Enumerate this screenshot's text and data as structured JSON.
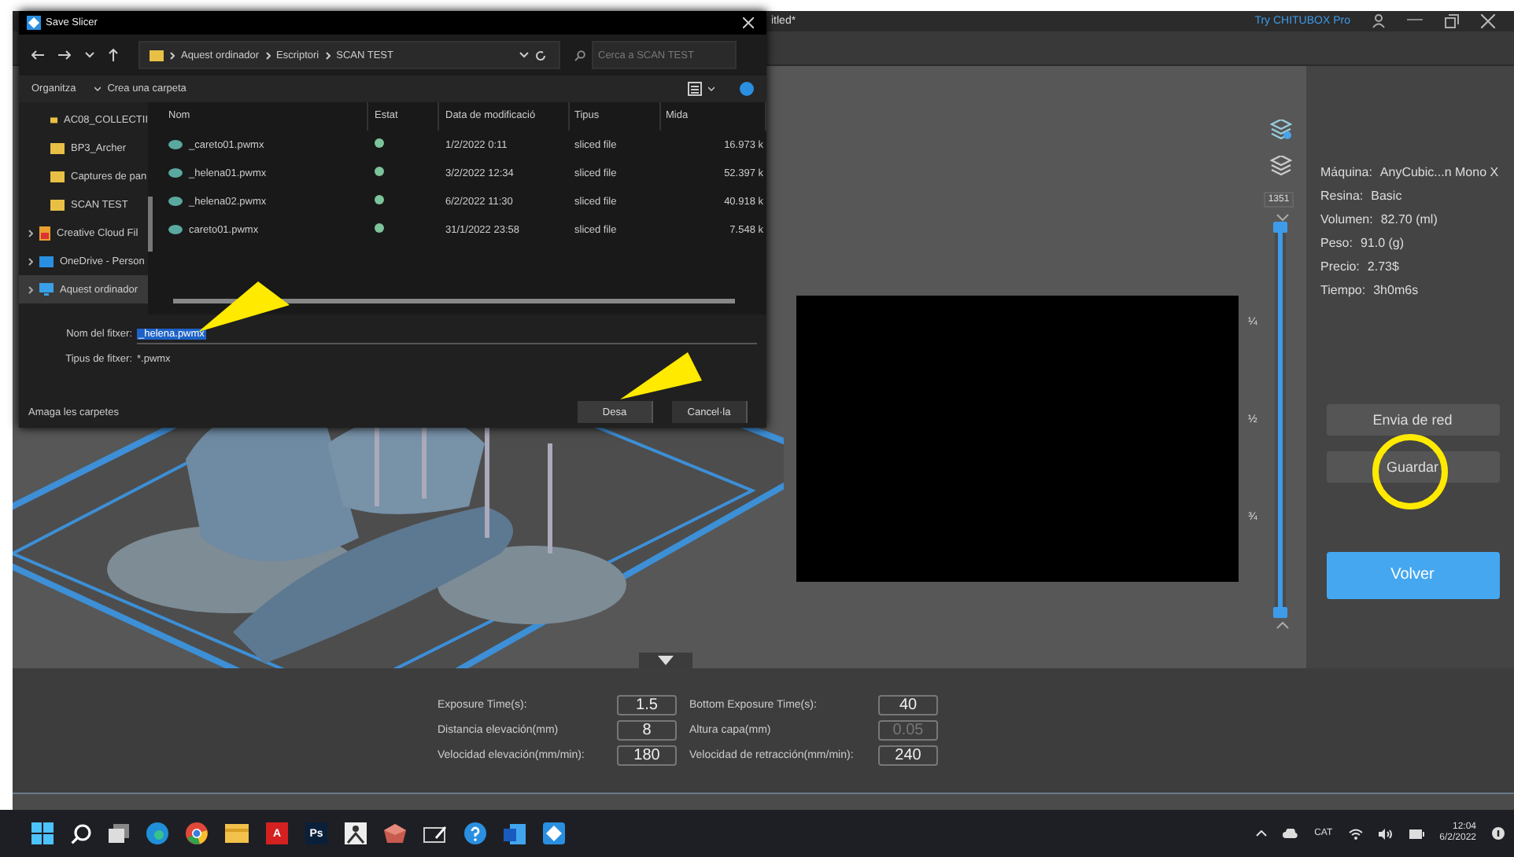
{
  "app": {
    "title_fragment": "itled*",
    "promo": "Try CHITUBOX Pro"
  },
  "dialog": {
    "title": "Save Slicer",
    "breadcrumb": [
      "Aquest ordinador",
      "Escriptori",
      "SCAN TEST"
    ],
    "search": {
      "placeholder": "Cerca a SCAN TEST"
    },
    "commands": [
      "Organitza",
      "Crea una carpeta"
    ],
    "nav": [
      {
        "label": "AC08_COLLECTII",
        "kind": "folder",
        "selected": false
      },
      {
        "label": "BP3_Archer",
        "kind": "folder",
        "selected": false
      },
      {
        "label": "Captures de pan",
        "kind": "folder",
        "selected": false
      },
      {
        "label": "SCAN TEST",
        "kind": "folder",
        "selected": false
      },
      {
        "label": "Creative Cloud Fil",
        "kind": "cloud",
        "selected": false
      },
      {
        "label": "OneDrive - Person",
        "kind": "onedrive",
        "selected": false
      },
      {
        "label": "Aquest ordinador",
        "kind": "computer",
        "selected": true
      }
    ],
    "columns": [
      "Nom",
      "Estat",
      "Data de modificació",
      "Tipus",
      "Mida"
    ],
    "files": [
      {
        "name": "_careto01.pwmx",
        "date": "1/2/2022 0:11",
        "type": "sliced file",
        "size": "16.973 k"
      },
      {
        "name": "_helena01.pwmx",
        "date": "3/2/2022 12:34",
        "type": "sliced file",
        "size": "52.397 k"
      },
      {
        "name": "_helena02.pwmx",
        "date": "6/2/2022 11:30",
        "type": "sliced file",
        "size": "40.918 k"
      },
      {
        "name": "careto01.pwmx",
        "date": "31/1/2022 23:58",
        "type": "sliced file",
        "size": "7.548 k"
      }
    ],
    "filename": {
      "label": "Nom del fitxer:",
      "value": "_helena.pwmx"
    },
    "filetype": {
      "label": "Tipus de fitxer:",
      "value": "*.pwmx"
    },
    "hide_folders": "Amaga les carpetes",
    "buttons": [
      "Desa",
      "Cancel·la"
    ]
  },
  "preview": {
    "layer": "1351",
    "ticks": [
      "¼",
      "½",
      "¾"
    ],
    "slider": {
      "level": 1
    }
  },
  "info": [
    {
      "label": "Máquina:",
      "value": "AnyCubic...n Mono X"
    },
    {
      "label": "Resina:",
      "value": "Basic"
    },
    {
      "label": "Volumen:",
      "value": "82.70  (ml)"
    },
    {
      "label": "Peso:",
      "value": "91.0  (g)"
    },
    {
      "label": "Precio:",
      "value": "2.73$"
    },
    {
      "label": "Tiempo:",
      "value": "3h0m6s"
    }
  ],
  "actions": [
    {
      "label": "Envia de red",
      "kind": "secondary"
    },
    {
      "label": "Guardar",
      "kind": "secondary"
    },
    {
      "label": "Volver",
      "kind": "primary"
    }
  ],
  "params": [
    {
      "label": "Exposure Time(s):",
      "value": "1.5",
      "disabled": false
    },
    {
      "label": "Bottom Exposure Time(s):",
      "value": "40",
      "disabled": false
    },
    {
      "label": "Distancia elevación(mm)",
      "value": "8",
      "disabled": false
    },
    {
      "label": "Altura capa(mm)",
      "value": "0.05",
      "disabled": true
    },
    {
      "label": "Velocidad elevación(mm/min):",
      "value": "180",
      "disabled": false
    },
    {
      "label": "Velocidad de retracción(mm/min):",
      "value": "240",
      "disabled": false
    }
  ],
  "taskbar": {
    "apps": [
      {
        "kind": "start"
      },
      {
        "kind": "search"
      },
      {
        "kind": "taskview"
      },
      {
        "kind": "edge"
      },
      {
        "kind": "chrome"
      },
      {
        "kind": "folder"
      },
      {
        "kind": "tile",
        "label": "A",
        "color": "#d42020"
      },
      {
        "kind": "tile",
        "label": "Ps",
        "color": "#0a1f3a"
      },
      {
        "kind": "figure"
      },
      {
        "kind": "gem"
      },
      {
        "kind": "pen"
      },
      {
        "kind": "help"
      },
      {
        "kind": "word"
      },
      {
        "kind": "chitubox"
      }
    ],
    "language": "CAT",
    "time": "12:04",
    "date": "6/2/2022"
  }
}
